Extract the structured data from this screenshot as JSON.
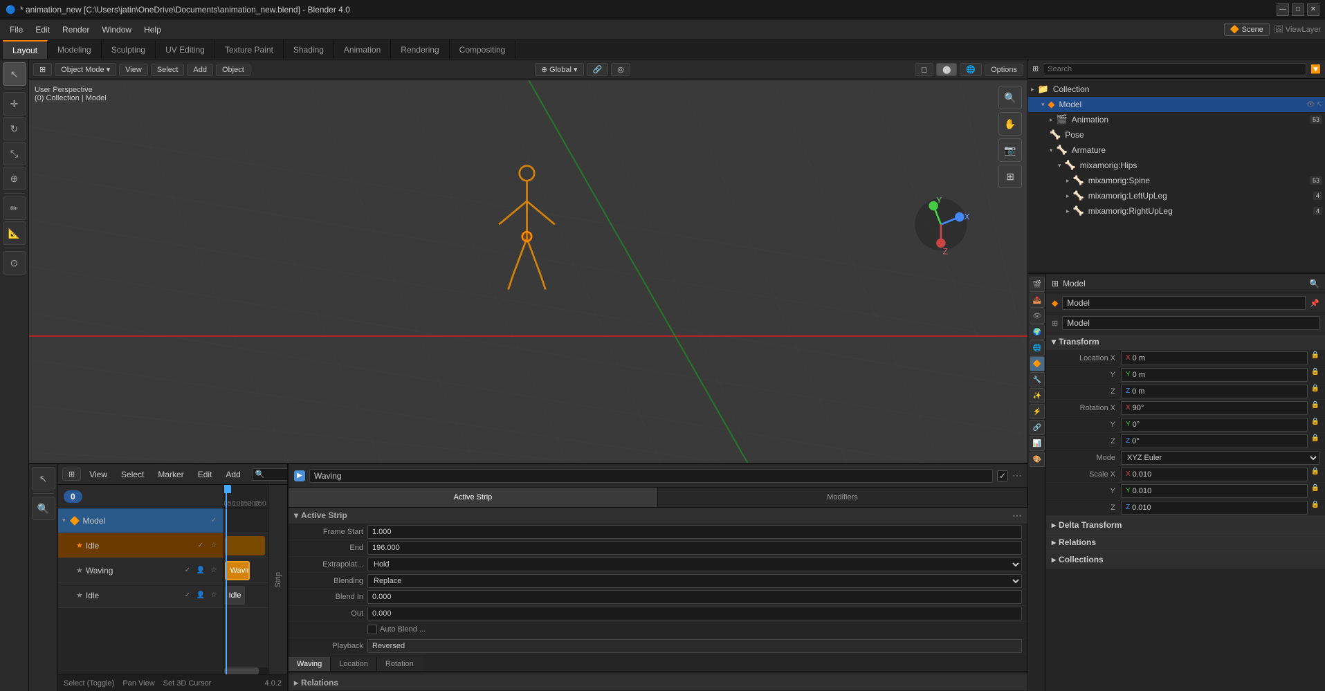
{
  "title": "* animation_new [C:\\Users\\jatin\\OneDrive\\Documents\\animation_new.blend] - Blender 4.0",
  "titlebar": {
    "minimize": "—",
    "maximize": "□",
    "close": "✕"
  },
  "menu": {
    "items": [
      "File",
      "Edit",
      "Render",
      "Window",
      "Help"
    ]
  },
  "workspace_tabs": [
    {
      "label": "Layout",
      "active": true
    },
    {
      "label": "Modeling",
      "active": false
    },
    {
      "label": "Sculpting",
      "active": false
    },
    {
      "label": "UV Editing",
      "active": false
    },
    {
      "label": "Texture Paint",
      "active": false
    },
    {
      "label": "Shading",
      "active": false
    },
    {
      "label": "Animation",
      "active": false
    },
    {
      "label": "Rendering",
      "active": false
    },
    {
      "label": "Compositing",
      "active": false
    }
  ],
  "viewport": {
    "mode": "Object Mode",
    "view": "View",
    "select": "Select",
    "add": "Add",
    "object": "Object",
    "transform": "Global",
    "info": "User Perspective",
    "collection": "(0) Collection | Model",
    "options_btn": "Options"
  },
  "outliner": {
    "search_placeholder": "Search",
    "items": [
      {
        "label": "Collection",
        "indent": 0,
        "arrow": "▸",
        "icon": "📁"
      },
      {
        "label": "Model",
        "indent": 1,
        "arrow": "▾",
        "icon": "🔶",
        "selected": true
      },
      {
        "label": "Animation",
        "indent": 2,
        "arrow": "▸",
        "icon": "🎬"
      },
      {
        "label": "Pose",
        "indent": 2,
        "arrow": "",
        "icon": "🦴"
      },
      {
        "label": "Armature",
        "indent": 2,
        "arrow": "▾",
        "icon": "🦴"
      },
      {
        "label": "mixamorig:Hips",
        "indent": 3,
        "arrow": "▾",
        "icon": "🦴"
      },
      {
        "label": "mixamorig:Spine",
        "indent": 4,
        "arrow": "▸",
        "icon": "🦴",
        "badge": "53"
      },
      {
        "label": "mixamorig:LeftUpLeg",
        "indent": 4,
        "arrow": "▸",
        "icon": "🦴",
        "badge": "4"
      },
      {
        "label": "mixamorig:RightUpLeg",
        "indent": 4,
        "arrow": "▸",
        "icon": "🦴",
        "badge": "4"
      }
    ]
  },
  "properties": {
    "object_name": "Model",
    "transform": {
      "label": "Transform",
      "location_x": "0 m",
      "location_y": "0 m",
      "location_z": "0 m",
      "rotation_x": "90°",
      "rotation_y": "0°",
      "rotation_z": "0°",
      "mode": "XYZ Euler",
      "scale_x": "0.010",
      "scale_y": "0.010",
      "scale_z": "0.010"
    },
    "delta_transform": "Delta Transform",
    "relations": "Relations",
    "collections": "Collections"
  },
  "nla_editor": {
    "menu_items": [
      "View",
      "Select",
      "Marker",
      "Edit",
      "Add"
    ],
    "search_placeholder": "🔍",
    "tracks": [
      {
        "name": "Model",
        "type": "model"
      },
      {
        "name": "Idle",
        "type": "idle"
      },
      {
        "name": "Waving",
        "type": "waving"
      },
      {
        "name": "Idle",
        "type": "idle2"
      }
    ],
    "ruler_marks": [
      0,
      50,
      100,
      150,
      200,
      250
    ],
    "strips": {
      "idle_strip": {
        "label": "Idle",
        "left_pct": 0,
        "width_pct": 95
      },
      "waving_strip": {
        "label": "Waving",
        "left_pct": 0,
        "width_pct": 58
      },
      "idle2_strip": {
        "label": "Idle",
        "left_pct": 0,
        "width_pct": 48
      }
    }
  },
  "strip_properties": {
    "name": "Waving",
    "active_strip_label": "Active Strip",
    "frame_start_label": "Frame Start",
    "frame_start": "1.000",
    "end_label": "End",
    "end": "196.000",
    "extrapolate_label": "Extrapolat...",
    "extrapolate": "Hold",
    "blending_label": "Blending",
    "blending": "Replace",
    "blend_in_label": "Blend In",
    "blend_in": "0.000",
    "out_label": "Out",
    "out_val": "0.000",
    "auto_blend_label": "Auto Blend ...",
    "playback_label": "Playback",
    "playback_val": "Reversed",
    "tabs": [
      {
        "label": "Active Strip",
        "active": true
      },
      {
        "label": "Rotation",
        "active": false
      }
    ],
    "tab_waving": "Waving",
    "tab_modifiers": "Modifiers",
    "relations_label": "Relations",
    "location_label": "Location"
  },
  "status_bar": {
    "select": "Select (Toggle)",
    "pan": "Pan View",
    "cursor": "Set 3D Cursor",
    "version": "4.0.2"
  }
}
